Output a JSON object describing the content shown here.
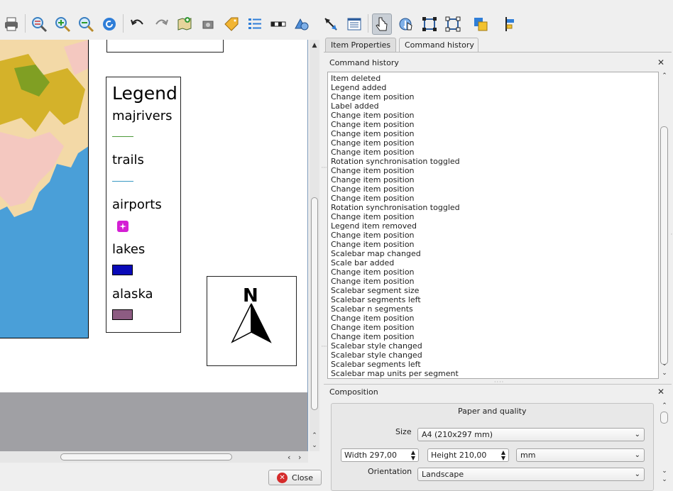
{
  "toolbar": {
    "icons": [
      "print-icon",
      "zoom-full-icon",
      "zoom-in-icon",
      "zoom-out-icon",
      "refresh-icon",
      "undo-icon",
      "redo-icon",
      "add-map-icon",
      "add-image-icon",
      "add-label-icon",
      "add-legend-icon",
      "add-scalebar-icon",
      "add-shape-icon",
      "add-arrow-icon",
      "add-table-icon",
      "select-move-icon",
      "move-content-icon",
      "group-icon",
      "ungroup-icon",
      "raise-icon",
      "align-icon"
    ]
  },
  "legend": {
    "title": "Legend",
    "items": [
      {
        "name": "majrivers",
        "kind": "line",
        "color": "#4d9a3a"
      },
      {
        "name": "trails",
        "kind": "line",
        "color": "#3a9ac4"
      },
      {
        "name": "airports",
        "kind": "symbol",
        "color": "#d41fd4"
      },
      {
        "name": "lakes",
        "kind": "fill",
        "color": "#0a0ab8"
      },
      {
        "name": "alaska",
        "kind": "fill",
        "color": "#8d5c82"
      }
    ]
  },
  "north_arrow": {
    "label": "N"
  },
  "buttons": {
    "close": "Close"
  },
  "tabs": [
    {
      "label": "Item Properties",
      "active": false
    },
    {
      "label": "Command history",
      "active": true
    }
  ],
  "history": {
    "title": "Command history",
    "entries": [
      "Item deleted",
      "Legend added",
      "Change item position",
      "Label added",
      "Change item position",
      "Change item position",
      "Change item position",
      "Change item position",
      "Change item position",
      "Rotation synchronisation toggled",
      "Change item position",
      "Change item position",
      "Change item position",
      "Change item position",
      "Rotation synchronisation toggled",
      "Change item position",
      "Legend item removed",
      "Change item position",
      "Change item position",
      "Scalebar map changed",
      "Scale bar added",
      "Change item position",
      "Change item position",
      "Scalebar segment size",
      "Scalebar segments left",
      "Scalebar n segments",
      "Change item position",
      "Change item position",
      "Change item position",
      "Scalebar style changed",
      "Scalebar style changed",
      "Scalebar segments left",
      "Scalebar map units per segment"
    ]
  },
  "composition": {
    "title": "Composition",
    "section": "Paper and quality",
    "size_label": "Size",
    "size_value": "A4 (210x297 mm)",
    "width": "Width 297,00",
    "height": "Height 210,00",
    "units": "mm",
    "orientation_label": "Orientation",
    "orientation_value": "Landscape"
  },
  "colors": {
    "map_water": "#4a9fd8",
    "map_land": "#f3d9a7",
    "map_urban": "#f4c8c0",
    "map_forest": "#c9a400",
    "map_green": "#6a9a22"
  }
}
